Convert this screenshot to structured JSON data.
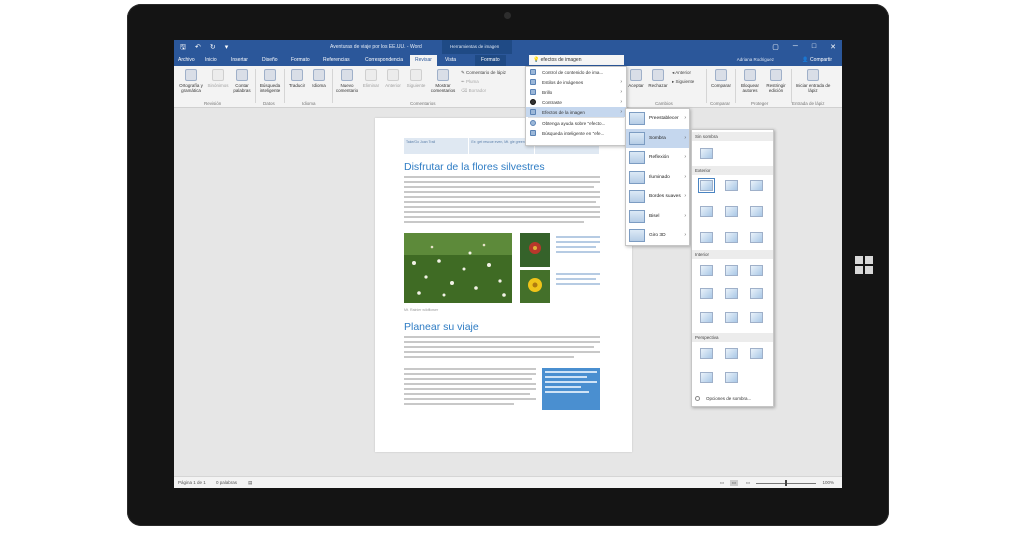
{
  "window": {
    "title": "Aventuras de viaje por los EE.UU. - Word",
    "contextual_tools": "Herramientas de imagen",
    "user": "Adriana Rodriguez",
    "share_label": "Compartir",
    "search_placeholder": "efectos de imagen",
    "controls": [
      "▢",
      "─",
      "□",
      "✕"
    ]
  },
  "tabs": [
    {
      "label": "Archivo",
      "active": false
    },
    {
      "label": "Inicio",
      "active": false
    },
    {
      "label": "Insertar",
      "active": false
    },
    {
      "label": "Diseño",
      "active": false
    },
    {
      "label": "Formato",
      "active": false
    },
    {
      "label": "Referencias",
      "active": false
    },
    {
      "label": "Correspondencia",
      "active": false
    },
    {
      "label": "Revisar",
      "active": true
    },
    {
      "label": "Vista",
      "active": false
    },
    {
      "label": "Formato",
      "active": false
    }
  ],
  "ribbon": {
    "buttons": [
      {
        "label": "Ortografía y gramática",
        "dim": false
      },
      {
        "label": "Sinónimos",
        "dim": true
      },
      {
        "label": "Contar palabras",
        "dim": false
      },
      {
        "label": "Búsqueda inteligente",
        "dim": false
      },
      {
        "label": "Traducir",
        "dim": false
      },
      {
        "label": "Idioma",
        "dim": false
      },
      {
        "label": "Nuevo comentario",
        "dim": false
      },
      {
        "label": "Eliminar",
        "dim": true
      },
      {
        "label": "Anterior",
        "dim": true
      },
      {
        "label": "Siguiente",
        "dim": true
      },
      {
        "label": "Mostrar comentarios",
        "dim": false
      },
      {
        "label": "Aceptar",
        "dim": false
      },
      {
        "label": "Rechazar",
        "dim": false
      },
      {
        "label": "Comparar",
        "dim": false
      },
      {
        "label": "Bloquear autores",
        "dim": false
      },
      {
        "label": "Restringir edición",
        "dim": false
      },
      {
        "label": "Iniciar entrada de lápiz",
        "dim": false
      }
    ],
    "small": {
      "pen_comment": "Comentario de lápiz",
      "pen": "Pluma",
      "eraser": "Borrador",
      "previous": "Anterior",
      "next": "Siguiente"
    },
    "groups": [
      "Revisión",
      "Datos",
      "Idioma",
      "Comentarios",
      "Cambios",
      "Comparar",
      "Proteger",
      "Entrada de lápiz"
    ]
  },
  "document": {
    "table_cells": [
      "Take/Go Joan Trail",
      "Ex: get rescue even, Mt. gle green fee",
      "Longmire"
    ],
    "heading1": "Disfrutar de la flores silvestres",
    "heading2": "Planear su viaje",
    "caption": "Mt. Rainier wildflower"
  },
  "image_menu": {
    "items": [
      {
        "label": "Control de contenido de ima...",
        "has_arrow": false,
        "highlight": false
      },
      {
        "label": "Estilos de imágenes",
        "has_arrow": true,
        "highlight": false
      },
      {
        "label": "Brillo",
        "has_arrow": true,
        "highlight": false
      },
      {
        "label": "Contraste",
        "has_arrow": true,
        "highlight": false
      },
      {
        "label": "Efectos de la imagen",
        "has_arrow": true,
        "highlight": true
      },
      {
        "label": "Obtenga ayuda sobre \"efecto...",
        "has_arrow": false,
        "highlight": false
      },
      {
        "label": "Búsqueda inteligente en \"efe...",
        "has_arrow": false,
        "highlight": false
      }
    ]
  },
  "effects_menu": {
    "items": [
      {
        "label": "Preestablecer",
        "highlight": false
      },
      {
        "label": "Sombra",
        "highlight": true
      },
      {
        "label": "Reflexión",
        "highlight": false
      },
      {
        "label": "Iluminado",
        "highlight": false
      },
      {
        "label": "Bordes suaves",
        "highlight": false
      },
      {
        "label": "Bisel",
        "highlight": false
      },
      {
        "label": "Giro 3D",
        "highlight": false
      }
    ]
  },
  "shadow_gallery": {
    "no_shadow": "Sin sombra",
    "outer": "Exterior",
    "inner": "Interior",
    "perspective": "Perspectiva",
    "options": "Opciones de sombra..."
  },
  "status": {
    "page": "Página 1 de 1",
    "words": "0 palabras",
    "zoom": "100%"
  },
  "colors": {
    "word_blue": "#2b579a",
    "heading_blue": "#2e7cc4",
    "highlight": "#c5d7ee"
  }
}
